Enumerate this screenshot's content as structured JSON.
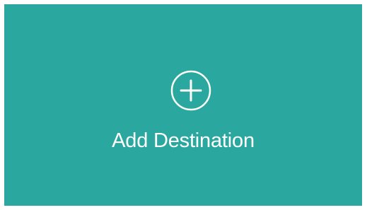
{
  "card": {
    "label": "Add Destination",
    "icon": "plus-circle-icon",
    "background_color": "#2aa79e",
    "text_color": "#ffffff"
  }
}
